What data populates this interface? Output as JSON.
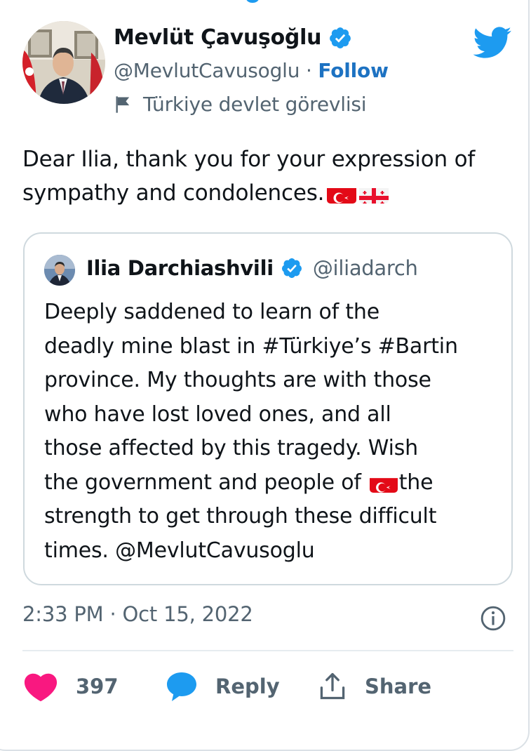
{
  "tweet": {
    "author_name": "Mevlüt Çavuşoğlu",
    "handle": "@MevlutCavusoglu",
    "separator": "·",
    "follow_label": "Follow",
    "account_label": "Türkiye devlet görevlisi",
    "text": "Dear Ilia, thank you for your expression of sympathy and condolences.",
    "text_emoji": [
      "flag-turkey",
      "flag-georgia"
    ],
    "timestamp": "2:33 PM · Oct 15, 2022"
  },
  "quoted_tweet": {
    "author_name": "Ilia Darchiashvili",
    "handle": "@iliadarch",
    "lines": [
      "Deeply saddened to learn of the",
      "deadly mine blast in #Türkiye’s #Bartin",
      "province. My thoughts are with those",
      "who have lost loved ones, and all",
      "those affected by this tragedy. Wish",
      "the government and people of",
      "the",
      "strength to get through these difficult",
      "times. @MevlutCavusoglu"
    ],
    "inline_emoji": "flag-turkey"
  },
  "actions": {
    "likes_count": "397",
    "reply_label": "Reply",
    "share_label": "Share"
  },
  "colors": {
    "twitter_blue": "#1d9bf0",
    "follow_blue": "#1d72c2",
    "heart_pink": "#f91880",
    "secondary_text": "#536471",
    "border": "#cfd9de"
  },
  "icons": [
    "verified-badge-icon",
    "twitter-bird-icon",
    "government-flag-icon",
    "info-icon",
    "heart-icon",
    "reply-bubble-icon",
    "share-icon"
  ]
}
